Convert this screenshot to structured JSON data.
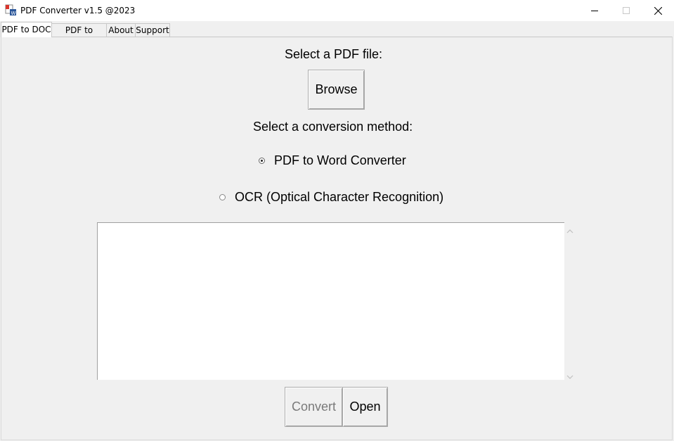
{
  "window": {
    "title": "PDF Converter v1.5 @2023",
    "controls": [
      "minimize-icon",
      "maximize-icon",
      "close-icon"
    ]
  },
  "tabs": [
    {
      "label": "PDF to DOC",
      "active": true
    },
    {
      "label": "PDF to Image",
      "active": false
    },
    {
      "label": "About",
      "active": false
    },
    {
      "label": "Support",
      "active": false
    }
  ],
  "main": {
    "select_pdf_label": "Select a PDF file:",
    "browse_button": "Browse",
    "method_label": "Select a conversion method:",
    "methods": [
      {
        "label": "PDF to Word Converter",
        "checked": true
      },
      {
        "label": "OCR (Optical Character Recognition)",
        "checked": false
      }
    ],
    "output_text": "",
    "convert_button": "Convert",
    "convert_enabled": false,
    "open_button": "Open"
  }
}
